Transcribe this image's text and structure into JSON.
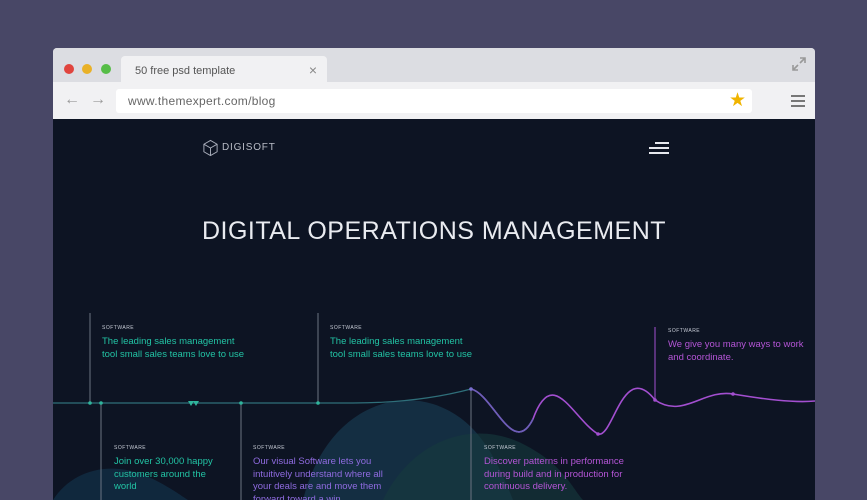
{
  "browser": {
    "tab_title": "50 free psd  template",
    "tab_close": "×",
    "url": "www.themexpert.com/blog",
    "back_glyph": "←",
    "forward_glyph": "→",
    "star_glyph": "★",
    "traffic_lights": [
      "#e0443e",
      "#e9b128",
      "#56bd47"
    ],
    "icons": [
      "close-icon",
      "expand-icon",
      "back-icon",
      "forward-icon",
      "star-icon",
      "menu-icon"
    ]
  },
  "site": {
    "logo": "DIGISOFT",
    "hero_title": "DIGITAL OPERATIONS MANAGEMENT",
    "accent_green": "#22c3a4",
    "accent_purple": "#b455d6",
    "accent_violet": "#8f6be0",
    "cards_top": [
      {
        "label": "SOFTWARE",
        "text": "The leading sales management tool small sales teams love to use"
      },
      {
        "label": "SOFTWARE",
        "text": "The leading sales management tool small sales teams love to use"
      },
      {
        "label": "SOFTWARE",
        "text": "We give you many ways to work and coordinate."
      }
    ],
    "cards_bottom": [
      {
        "label": "SOFTWARE",
        "text": "Join over 30,000 happy customers around the world"
      },
      {
        "label": "SOFTWARE",
        "text": "Our visual Software lets you intuitively understand where all your deals are and move them forward toward a win."
      },
      {
        "label": "SOFTWARE",
        "text": "Discover patterns in performance during build and in production for continuous delivery."
      }
    ]
  }
}
